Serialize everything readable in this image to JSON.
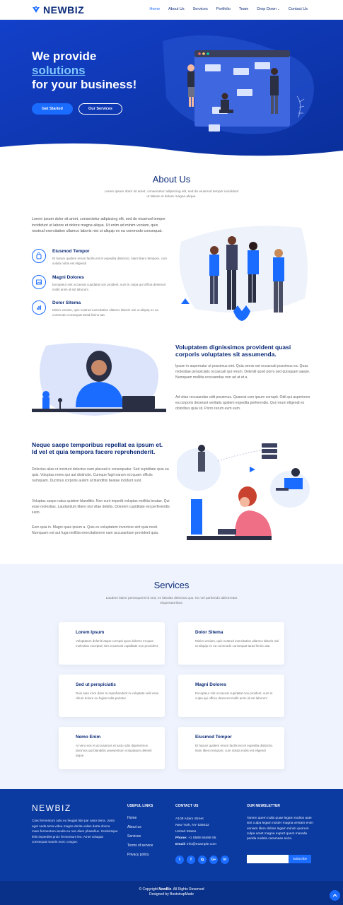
{
  "nav": {
    "logo": "NEWBIZ",
    "items": [
      {
        "label": "Home"
      },
      {
        "label": "About Us"
      },
      {
        "label": "Services"
      },
      {
        "label": "Portfolio"
      },
      {
        "label": "Team"
      },
      {
        "label": "Drop Down"
      },
      {
        "label": "Contact Us"
      }
    ]
  },
  "hero": {
    "line1": "We provide",
    "highlight": "solutions",
    "line3": "for your business!",
    "btn_primary": "Get Started",
    "btn_secondary": "Our Services"
  },
  "about": {
    "title": "About Us",
    "subtitle": "Lorem ipsum dolor sit amet, consectetur adipiscing elit, sed do eiusmod tempor incididunt ut labore et dolore magna aliqua.",
    "intro": "Lorem ipsum dolor sit amet, consectetur adipiscing elit, sed do eiusmod tempor incididunt ut labore et dolore magna aliqua. Ut enim ad minim veniam, quis nostrud exercitation ullamco laboris nisi ut aliquip ex ea commodo consequat.",
    "features": [
      {
        "title": "Eiusmod Tempor",
        "desc": "Et harum quidem rerum facilis est et expedita distinctio. Nam libero tempore, cum soluta nobis est eligendi",
        "icon": "shopping-bag-icon"
      },
      {
        "title": "Magni Dolores",
        "desc": "Excepteur sint occaecat cupidatat non proident, sunt in culpa qui officia deserunt mollit anim id est laborum",
        "icon": "image-icon"
      },
      {
        "title": "Dolor Sitema",
        "desc": "Minim veniam, quis nostrud exercitation ullamco laboris nisi ut aliquip ex ea commodo consequat tarad limino ata",
        "icon": "bar-chart-icon"
      }
    ]
  },
  "block1": {
    "title": "Voluptatem dignissimos provident quasi corporis voluptates sit assumenda.",
    "p1": "Ipsum in aspernatur ut possimus sint. Quia omnis est occaecati possimus ea. Quas molestiae perspiciatis occaecati qui rerum. Deleniti quod porro sed quisquam saepe. Numquam mollitia recusandae non ad at et a.",
    "p2": "Ad vitae recusandae odit possimus. Quaerat cum ipsum corrupti. Odit qui asperiores ea corporis deserunt veritatis quidem expedita perferendis. Qui rerum eligendi ex doloribus quia sit. Porro rerum eum eum."
  },
  "block2": {
    "title": "Neque saepe temporibus repellat ea ipsum et. Id vel et quia tempora facere reprehenderit.",
    "p1": "Delectus alias ut incidunt delectus nam placeat in consequatur. Sed cupiditate quia ea quis. Voluptas nemo qui aut distinctio. Cumque fugit earum est quam officiis numquam. Ducimus corporis autem at blanditiis beatae incidunt sunt.",
    "p2": "Voluptas saepe natus quidem blanditiis. Non sunt impedit voluptas mollitia beatae. Qui esse molestias. Laudantium libero nisi vitae debitis. Dolorem cupiditate est perferendis iusto.",
    "p3": "Eum quia in. Magni quas ipsum a. Quis ex voluptatem inventore sint quia modi. Numquam est aut fuga mollitia exercitationem nam accusantium provident quia."
  },
  "services": {
    "title": "Services",
    "subtitle": "Laudem latine persequeris id sed, ex fabulas delectus quo. No vel partiendo abhorreant vituperatoribus.",
    "cards": [
      {
        "title": "Lorem Ipsum",
        "desc": "Voluptatum deleniti atque corrupti quos dolores et quas molestias excepturi sint occaecati cupiditate non provident"
      },
      {
        "title": "Dolor Sitema",
        "desc": "Minim veniam, quis nostrud exercitation ullamco laboris nisi ut aliquip ex ea commodo consequat tarad limino ata"
      },
      {
        "title": "Sed ut perspiciatis",
        "desc": "Duis aute irure dolor in reprehenderit in voluptate velit esse cillum dolore eu fugiat nulla pariatur"
      },
      {
        "title": "Magni Dolores",
        "desc": "Excepteur sint occaecat cupidatat non proident, sunt in culpa qui officia deserunt mollit anim id est laborum"
      },
      {
        "title": "Nemo Enim",
        "desc": "At vero eos et accusamus et iusto odio dignissimos ducimus qui blanditiis praesentium voluptatum deleniti atque"
      },
      {
        "title": "Eiusmod Tempor",
        "desc": "Et harum quidem rerum facilis est et expedita distinctio. Nam libero tempore, cum soluta nobis est eligendi"
      }
    ]
  },
  "footer": {
    "logo": "NEWBIZ",
    "about": "Cras fermentum odio eu feugiat lide par naso tierra. Justo eget nada terra videa magna derita valies darta donna mare fermentum iaculis eu non diam phasellus. Scelerisque felis imperdiet proin fermentum leo. Amet volutpat consequat mauris nunc congue.",
    "links_head": "USEFUL LINKS",
    "links": [
      "Home",
      "About us",
      "Services",
      "Terms of service",
      "Privacy policy"
    ],
    "contact_head": "CONTACT US",
    "address1": "A108 Adam Street",
    "address2": "New York, NY 535022",
    "address3": "United States",
    "phone_label": "Phone:",
    "phone": "+1 5589 55488 55",
    "email_label": "Email:",
    "email": "info@example.com",
    "social": [
      "t",
      "f",
      "ig",
      "G+",
      "in"
    ],
    "news_head": "OUR NEWSLETTER",
    "news_text": "Tamen quem nulla quae legam multos aute sint culpa legam noster magna veniam enim veniam illum dolore legam minim quorum culpa amet magna export quem marada parida nodela caramase seza.",
    "subscribe": "Subscribe",
    "copyright_pre": "© Copyright",
    "copyright_brand": "NewBiz",
    "copyright_post": ". All Rights Reserved",
    "designed_by": "Designed by BootstrapMade"
  },
  "colors": {
    "primary": "#1a6bff",
    "navy": "#0b2a78",
    "footer": "#0b3aa0"
  }
}
